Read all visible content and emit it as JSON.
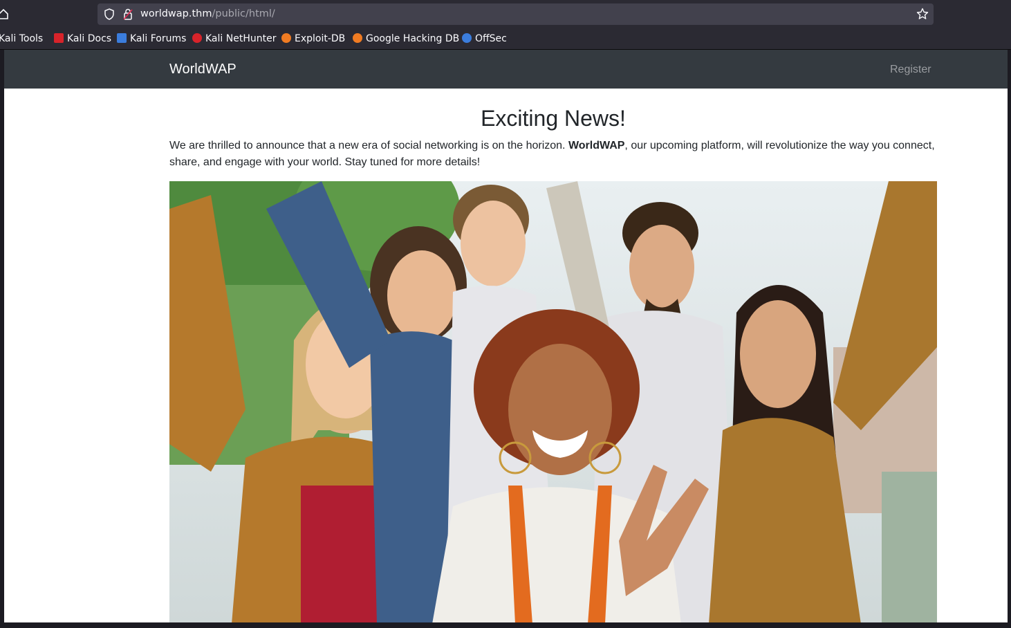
{
  "browser": {
    "url_host": "worldwap.thm",
    "url_path": "/public/html/",
    "bookmarks": [
      {
        "label": "Kali Tools",
        "icon": "kali-tools-icon",
        "color": "#ffffff"
      },
      {
        "label": "Kali Docs",
        "icon": "kali-docs-icon",
        "color": "#d8232a"
      },
      {
        "label": "Kali Forums",
        "icon": "kali-forums-icon",
        "color": "#3b7ddd"
      },
      {
        "label": "Kali NetHunter",
        "icon": "kali-nethunter-icon",
        "color": "#d8232a"
      },
      {
        "label": "Exploit-DB",
        "icon": "exploit-db-icon",
        "color": "#f07b22"
      },
      {
        "label": "Google Hacking DB",
        "icon": "google-hacking-db-icon",
        "color": "#f07b22"
      },
      {
        "label": "OffSec",
        "icon": "offsec-icon",
        "color": "#3b7ddd"
      }
    ]
  },
  "navbar": {
    "brand": "WorldWAP",
    "register": "Register"
  },
  "main": {
    "headline": "Exciting News!",
    "intro_before": "We are thrilled to announce that a new era of social networking is on the horizon. ",
    "intro_bold": "WorldWAP",
    "intro_after": ", our upcoming platform, will revolutionize the way you connect, share, and engage with your world. Stay tuned for more details!"
  },
  "colors": {
    "navbar_bg": "#343a40",
    "chrome_bg": "#2b2a33",
    "urlbar_bg": "#42414d"
  }
}
